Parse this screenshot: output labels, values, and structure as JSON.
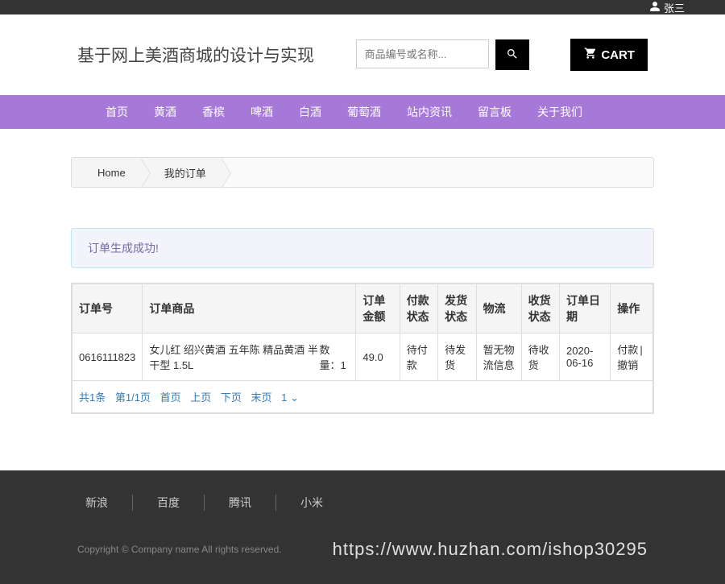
{
  "topbar": {
    "username": "张三"
  },
  "header": {
    "brand": "基于网上美酒商城的设计与实现",
    "search_placeholder": "商品编号或名称...",
    "cart_label": "CART"
  },
  "nav": {
    "items": [
      "首页",
      "黄酒",
      "香槟",
      "啤酒",
      "白酒",
      "葡萄酒",
      "站内资讯",
      "留言板",
      "关于我们"
    ]
  },
  "breadcrumb": {
    "home": "Home",
    "current": "我的订单"
  },
  "alert": {
    "message": "订单生成成功!"
  },
  "table": {
    "headers": {
      "order_no": "订单号",
      "product": "订单商品",
      "amount": "订单金额",
      "pay_status": "付款状态",
      "ship_status": "发货状态",
      "logistics": "物流",
      "receive_status": "收货状态",
      "order_date": "订单日期",
      "actions": "操作"
    },
    "rows": [
      {
        "order_no": "0616111823",
        "product_name": "女儿红 绍兴黄酒 五年陈 精品黄酒 半干型 1.5L",
        "qty_label": "数量：",
        "qty": "1",
        "amount": "49.0",
        "pay_status": "待付款",
        "ship_status": "待发货",
        "logistics": "暂无物流信息",
        "receive_status": "待收货",
        "order_date": "2020-06-16",
        "action_pay": "付款",
        "action_cancel": "撤销"
      }
    ]
  },
  "pagination": {
    "total": "共1条",
    "page": "第1/1页",
    "first": "首页",
    "prev": "上页",
    "next": "下页",
    "last": "末页",
    "current": "1"
  },
  "footer": {
    "links": [
      "新浪",
      "百度",
      "腾讯",
      "小米"
    ],
    "copyright": "Copyright © Company name All rights reserved.",
    "watermark": "https://www.huzhan.com/ishop30295"
  }
}
